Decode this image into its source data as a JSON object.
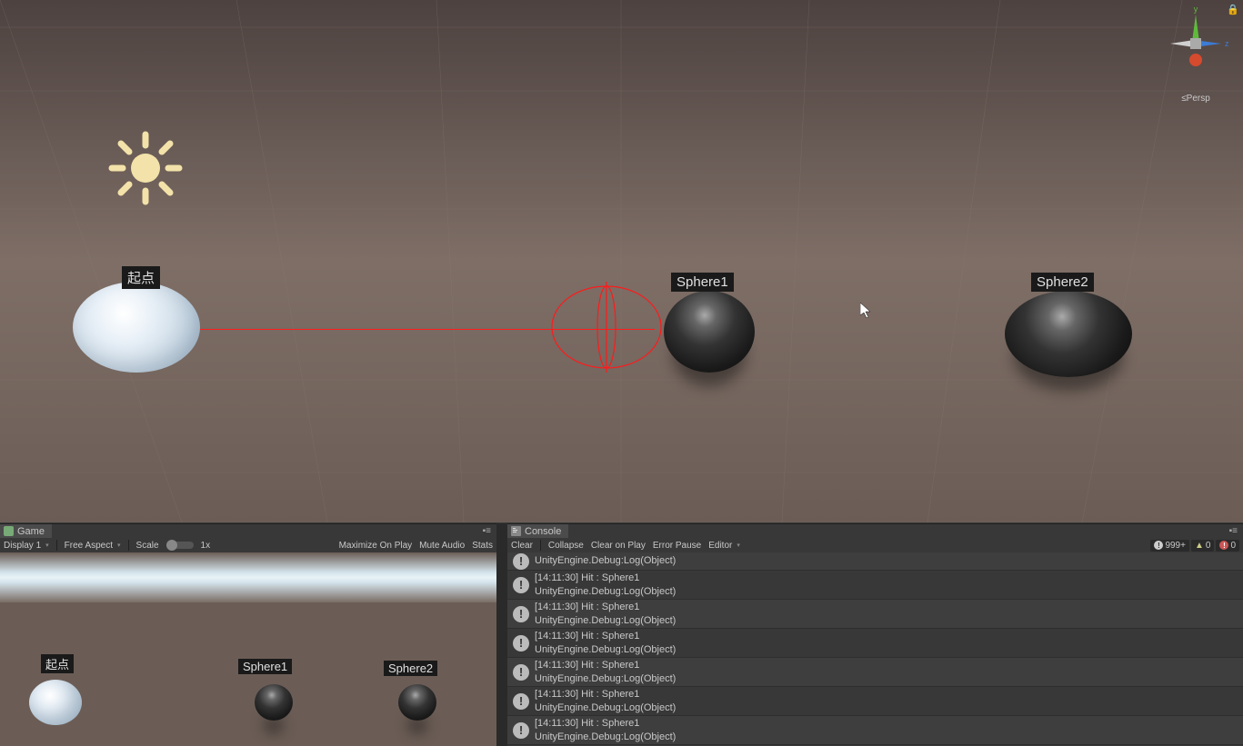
{
  "scene": {
    "labels": {
      "origin": "起点",
      "sphere1": "Sphere1",
      "sphere2": "Sphere2"
    },
    "gizmo": {
      "y": "y",
      "z": "z",
      "persp": "≤Persp"
    }
  },
  "game_panel": {
    "tab": "Game",
    "display": "Display 1",
    "aspect": "Free Aspect",
    "scale_label": "Scale",
    "scale_value": "1x",
    "maximize": "Maximize On Play",
    "mute": "Mute Audio",
    "stats": "Stats",
    "labels": {
      "origin": "起点",
      "sphere1": "Sphere1",
      "sphere2": "Sphere2"
    }
  },
  "console_panel": {
    "tab": "Console",
    "clear": "Clear",
    "collapse": "Collapse",
    "clear_on_play": "Clear on Play",
    "error_pause": "Error Pause",
    "editor": "Editor",
    "counts": {
      "info": "999+",
      "warn": "0",
      "error": "0"
    },
    "logs": [
      {
        "line1": "UnityEngine.Debug:Log(Object)"
      },
      {
        "line1": "[14:11:30] Hit : Sphere1",
        "line2": "UnityEngine.Debug:Log(Object)"
      },
      {
        "line1": "[14:11:30] Hit : Sphere1",
        "line2": "UnityEngine.Debug:Log(Object)"
      },
      {
        "line1": "[14:11:30] Hit : Sphere1",
        "line2": "UnityEngine.Debug:Log(Object)"
      },
      {
        "line1": "[14:11:30] Hit : Sphere1",
        "line2": "UnityEngine.Debug:Log(Object)"
      },
      {
        "line1": "[14:11:30] Hit : Sphere1",
        "line2": "UnityEngine.Debug:Log(Object)"
      },
      {
        "line1": "[14:11:30] Hit : Sphere1",
        "line2": "UnityEngine.Debug:Log(Object)"
      }
    ]
  }
}
